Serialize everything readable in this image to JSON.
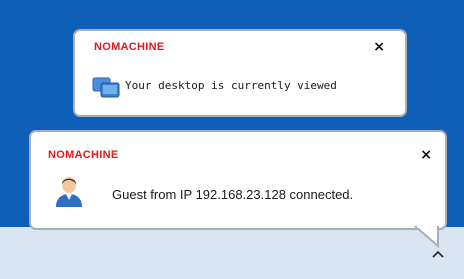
{
  "notifications": [
    {
      "brand": "NOMACHINE",
      "close_label": "×",
      "message": "Your desktop is currently viewed",
      "icon": "desktop-icon"
    },
    {
      "brand": "NOMACHINE",
      "close_label": "×",
      "message": "Guest from IP 192.168.23.128 connected.",
      "icon": "user-icon"
    }
  ],
  "taskbar": {
    "tray_chevron": "^"
  },
  "colors": {
    "desktop_bg": "#0d5fb8",
    "brand_red": "#e0191f",
    "taskbar": "#d9e6f2"
  }
}
